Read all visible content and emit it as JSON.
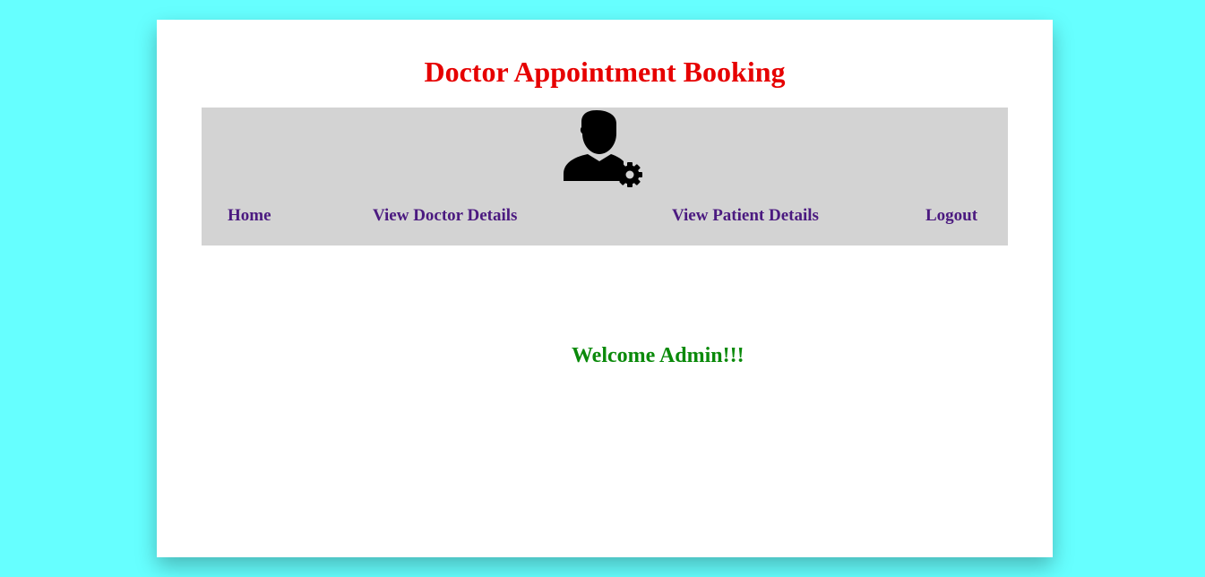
{
  "header": {
    "title": "Doctor Appointment Booking"
  },
  "nav": {
    "icon": "admin-user-gear-icon",
    "links": [
      {
        "label": "Home"
      },
      {
        "label": "View Doctor Details"
      },
      {
        "label": "View Patient Details"
      },
      {
        "label": "Logout"
      }
    ]
  },
  "main": {
    "welcome": "Welcome Admin!!!"
  },
  "colors": {
    "page_background": "#66ffff",
    "title": "#e60000",
    "navbar_background": "#d3d3d3",
    "nav_link": "#4b1a80",
    "welcome": "#0b8a0b"
  }
}
